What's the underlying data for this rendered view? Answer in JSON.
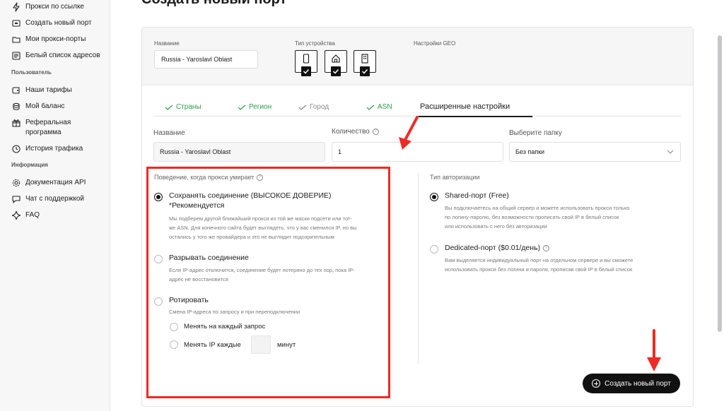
{
  "sidebar": {
    "items_top": [
      {
        "label": "Прокси по ссылке",
        "icon": "bolt-icon"
      },
      {
        "label": "Создать новый порт",
        "icon": "port-icon"
      },
      {
        "label": "Мои прокси-порты",
        "icon": "folder-icon"
      },
      {
        "label": "Белый список адресов",
        "icon": "list-icon"
      }
    ],
    "section_user": "Пользователь",
    "items_user": [
      {
        "label": "Наши тарифы",
        "icon": "wallet-icon"
      },
      {
        "label": "Мой баланс",
        "icon": "coins-icon"
      },
      {
        "label": "Реферальная",
        "label2": "программа",
        "icon": "gift-icon"
      },
      {
        "label": "История трафика",
        "icon": "history-icon"
      }
    ],
    "section_info": "Информация",
    "items_info": [
      {
        "label": "Документация API",
        "icon": "gear-icon"
      },
      {
        "label": "Чат с поддержкой",
        "icon": "chat-icon"
      },
      {
        "label": "FAQ",
        "icon": "sparkle-icon"
      }
    ]
  },
  "page": {
    "title": "Создать новый порт"
  },
  "top": {
    "name_label": "Название",
    "name_value": "Russia - Yaroslavl Oblast",
    "device_label": "Тип устройства",
    "geo_label": "Настройки GEO",
    "devices": [
      "mobile-icon",
      "home-icon",
      "building-icon"
    ]
  },
  "tabs": [
    {
      "label": "Страны",
      "state": "done"
    },
    {
      "label": "Регион",
      "state": "done"
    },
    {
      "label": "Город",
      "state": "gray"
    },
    {
      "label": "ASN",
      "state": "done"
    },
    {
      "label": "Расширенные настройки",
      "state": "active"
    }
  ],
  "fields": {
    "name_label": "Название",
    "name_value": "Russia - Yaroslavl Oblast",
    "qty_label": "Количество",
    "qty_value": "1",
    "folder_label": "Выберите папку",
    "folder_value": "Без папки"
  },
  "behavior": {
    "label": "Поведение, когда прокси умирает",
    "options": [
      {
        "title1": "Сохранять соединение (ВЫСОКОЕ ДОВЕРИЕ)",
        "title2": "*Рекомендуется",
        "desc": [
          "Мы подберем другой ближайший прокси из той же маски подсети или тот-",
          "же ASN. Для конечного сайта будет выглядеть, что у вас сменился IP, но вы",
          "остались у того же провайдера и это не выглядит подозрительным"
        ],
        "selected": true
      },
      {
        "title1": "Разрывать соединение",
        "desc": [
          "Если IP-адрес отключится, соединение будет потеряно до тех пор, пока IP-",
          "адрес не восстановится"
        ],
        "selected": false
      },
      {
        "title1": "Ротировать",
        "desc": [
          "Смена IP-адреса по запросу и при переподключении"
        ],
        "selected": false
      }
    ],
    "sub_every_request": "Менять на каждый запрос",
    "sub_every_ip": "Менять IP каждые",
    "sub_minutes": "минут"
  },
  "auth": {
    "label": "Тип авторизации",
    "options": [
      {
        "title": "Shared-порт (Free)",
        "desc": [
          "Вы подключаетесь на общий сервер и можете использовать прокси только",
          "по логину-паролю, без возможности прописать свой IP в белый список",
          "или использовать с него без авторизации"
        ],
        "selected": true
      },
      {
        "title": "Dedicated-порт ($0.01/день)",
        "desc": [
          "Вам выделяется индивидуальный порт на отдельном сервере и вы сможете",
          "использовать прокси без логина и пароля, прописав свой IP в белый список"
        ],
        "selected": false
      }
    ]
  },
  "button": {
    "create_label": "Создать новый порт"
  },
  "colors": {
    "accent_green": "#2a9c4a",
    "annotation_red": "#ee2a24",
    "button_dark": "#111111"
  }
}
